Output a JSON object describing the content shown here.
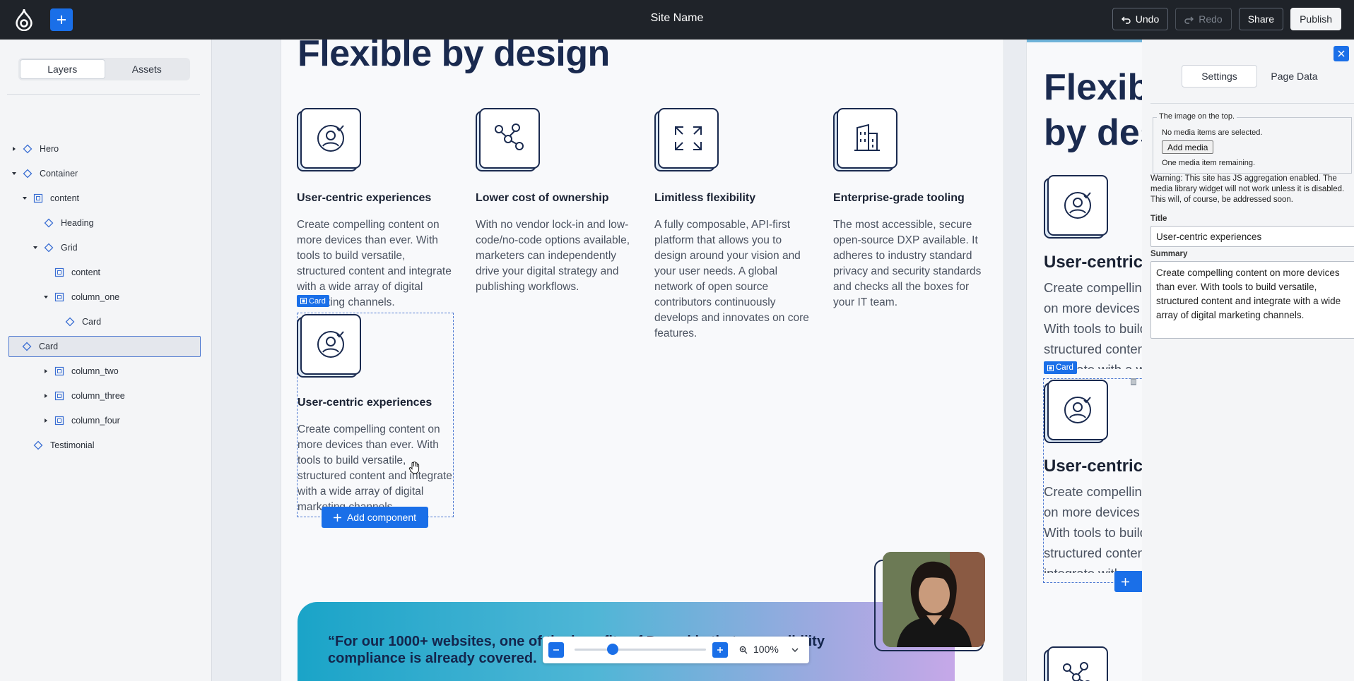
{
  "topbar": {
    "site_name": "Site Name",
    "undo": "Undo",
    "redo": "Redo",
    "share": "Share",
    "publish": "Publish"
  },
  "left": {
    "tabs": [
      "Layers",
      "Assets"
    ],
    "active_tab": "Layers",
    "tree": [
      {
        "label": "Hero",
        "icon": "component-diamond-icon",
        "caret": "right",
        "level": 0
      },
      {
        "label": "Container",
        "icon": "component-diamond-icon",
        "caret": "down",
        "level": 0
      },
      {
        "label": "content",
        "icon": "slot-square-icon",
        "caret": "down",
        "level": 1
      },
      {
        "label": "Heading",
        "icon": "component-diamond-icon",
        "caret": "none",
        "level": 2
      },
      {
        "label": "Grid",
        "icon": "component-diamond-icon",
        "caret": "down",
        "level": 2
      },
      {
        "label": "content",
        "icon": "slot-square-icon",
        "caret": "none",
        "level": 3
      },
      {
        "label": "column_one",
        "icon": "slot-square-icon",
        "caret": "down",
        "level": 3
      },
      {
        "label": "Card",
        "icon": "component-diamond-icon",
        "caret": "none",
        "level": 4
      },
      {
        "label": "Card",
        "icon": "component-diamond-icon",
        "caret": "none",
        "level": 4,
        "selected": true
      },
      {
        "label": "column_two",
        "icon": "slot-square-icon",
        "caret": "right",
        "level": 3
      },
      {
        "label": "column_three",
        "icon": "slot-square-icon",
        "caret": "right",
        "level": 3
      },
      {
        "label": "column_four",
        "icon": "slot-square-icon",
        "caret": "right",
        "level": 3
      },
      {
        "label": "Testimonial",
        "icon": "component-diamond-icon",
        "caret": "none",
        "level": 1
      }
    ]
  },
  "canvas": {
    "heading": "Flexible by design",
    "features": [
      {
        "icon": "user-check-icon",
        "title": "User-centric experiences",
        "body": "Create compelling content on more devices than ever. With tools to build versatile, structured content and integrate with a wide array of digital marketing channels."
      },
      {
        "icon": "nodes-icon",
        "title": "Lower cost of ownership",
        "body": "With no vendor lock-in and low-code/no-code options available, marketers can independently drive your digital strategy and publishing workflows."
      },
      {
        "icon": "expand-arrows-icon",
        "title": "Limitless flexibility",
        "body": "A fully composable, API-first platform that allows you to design around your vision and your user needs. A global network of open source contributors continuously develops and innovates on core features."
      },
      {
        "icon": "building-icon",
        "title": "Enterprise-grade tooling",
        "body": "The most accessible, secure open-source DXP available. It adheres to industry standard privacy and security standards and checks all the boxes for your IT team."
      }
    ],
    "selected_card": {
      "tag": "Card",
      "title": "User-centric experiences",
      "body": "Create compelling content on more devices than ever. With tools to build versatile, structured content and integrate with a wide array of digital marketing channels."
    },
    "add_component": "Add component",
    "testimonial_quote": "“For our 1000+ websites, one of the benefits of Drupal is that accessibility compliance is already covered.",
    "zoom": {
      "level": "100%",
      "fraction": 0.16
    }
  },
  "preview": {
    "heading": "Flexible by design",
    "card_title": "User-centric experiences",
    "card_body": "Create compelling content on more devices than ever. With tools to build versatile, structured content and integrate with a wide array of digital marketing channels.",
    "tag": "Card"
  },
  "settings": {
    "tabs": [
      "Settings",
      "Page Data"
    ],
    "active_tab": "Settings",
    "image_legend": "The image on the top.",
    "no_media": "No media items are selected.",
    "add_media": "Add media",
    "remaining": "One media item remaining.",
    "warning": "Warning: This site has JS aggregation enabled. The media library widget will not work unless it is disabled. This will, of course, be addressed soon.",
    "title_label": "Title",
    "title_value": "User-centric experiences",
    "summary_label": "Summary",
    "summary_value": "Create compelling content on more devices than ever. With tools to build versatile, structured content and integrate with a wide array of digital marketing channels."
  },
  "colors": {
    "accent": "#1a6fe8",
    "topbar": "#1f2329",
    "heading": "#1a2a4f"
  }
}
